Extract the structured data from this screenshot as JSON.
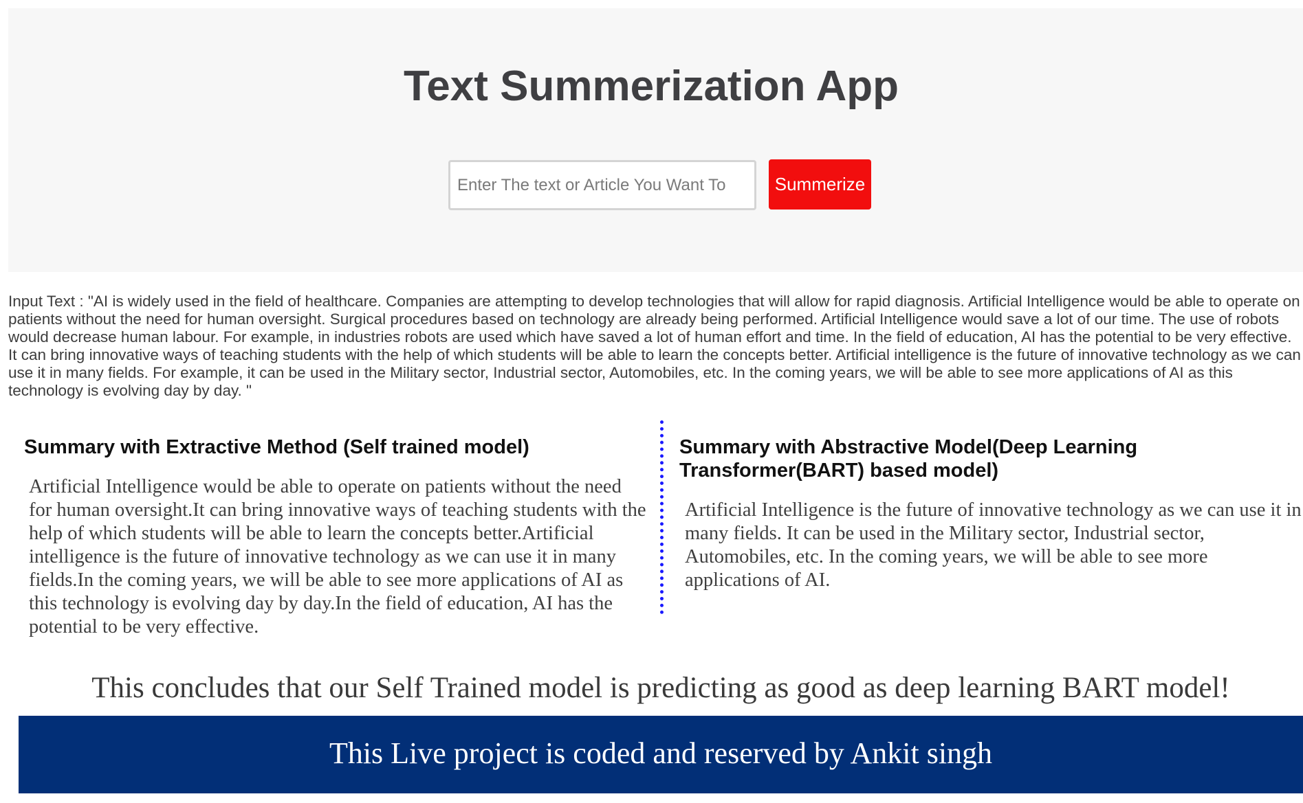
{
  "header": {
    "title": "Text Summerization App",
    "search_placeholder": "Enter The text or Article You Want To",
    "search_value": "",
    "summarize_label": "Summerize"
  },
  "input_text": "Input Text : \"AI is widely used in the field of healthcare. Companies are attempting to develop technologies that will allow for rapid diagnosis. Artificial Intelligence would be able to operate on patients without the need for human oversight. Surgical procedures based on technology are already being performed. Artificial Intelligence would save a lot of our time. The use of robots would decrease human labour. For example, in industries robots are used which have saved a lot of human effort and time. In the field of education, AI has the potential to be very effective. It can bring innovative ways of teaching students with the help of which students will be able to learn the concepts better. Artificial intelligence is the future of innovative technology as we can use it in many fields. For example, it can be used in the Military sector, Industrial sector, Automobiles, etc. In the coming years, we will be able to see more applications of AI as this technology is evolving day by day. \"",
  "extractive": {
    "heading": "Summary with Extractive Method (Self trained model)",
    "summary": "Artificial Intelligence would be able to operate on patients without the need for human oversight.It can bring innovative ways of teaching students with the help of which students will be able to learn the concepts better.Artificial intelligence is the future of innovative technology as we can use it in many fields.In the coming years, we will be able to see more applications of AI as this technology is evolving day by day.In the field of education, AI has the potential to be very effective."
  },
  "abstractive": {
    "heading": "Summary with Abstractive Model(Deep Learning Transformer(BART) based model)",
    "summary": "Artificial Intelligence is the future of innovative technology as we can use it in many fields. It can be used in the Military sector, Industrial sector, Automobiles, etc. In the coming years, we will be able to see more applications of AI."
  },
  "conclusion": "This concludes that our Self Trained model is predicting as good as deep learning BART model!",
  "footer": {
    "text": "This Live project is coded and reserved by Ankit singh"
  },
  "colors": {
    "header_bg": "#f7f7f7",
    "button_bg": "#f20e0e",
    "divider": "#1a1aff",
    "footer_bg": "#022f77"
  }
}
